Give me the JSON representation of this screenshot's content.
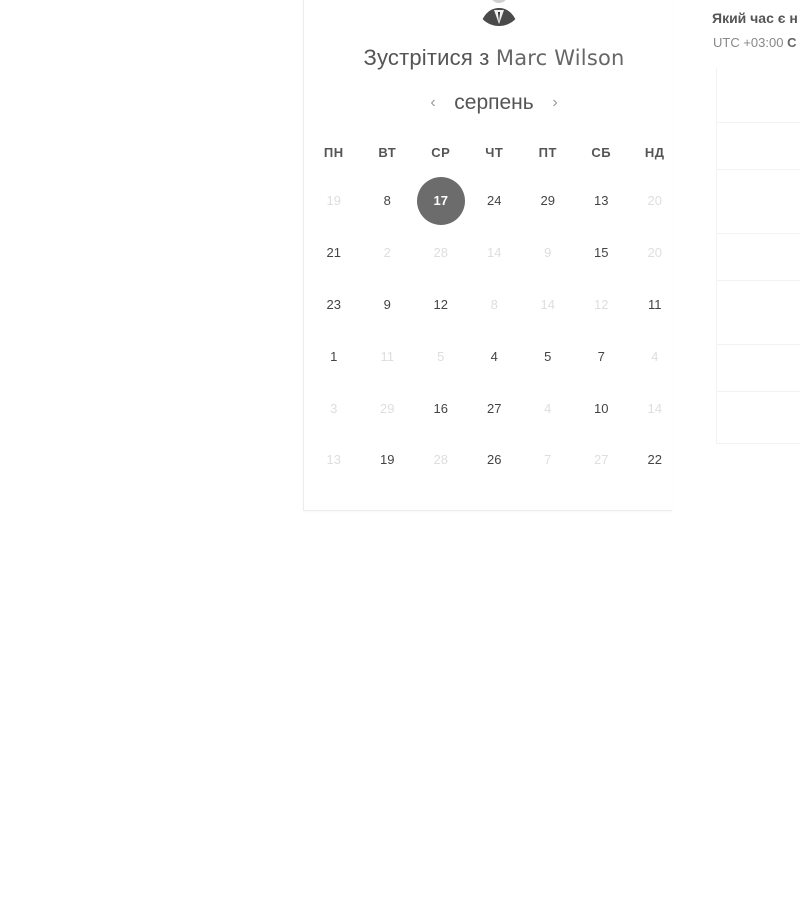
{
  "title": {
    "prefix": "Зустрітися з",
    "name": "Marc Wilson"
  },
  "calendar": {
    "month": "серпень",
    "weekdays": [
      "ПН",
      "ВТ",
      "СР",
      "ЧТ",
      "ПТ",
      "СБ",
      "НД"
    ],
    "weeks": [
      [
        {
          "d": "19",
          "m": true
        },
        {
          "d": "8"
        },
        {
          "d": "17",
          "sel": true
        },
        {
          "d": "24"
        },
        {
          "d": "29"
        },
        {
          "d": "13"
        },
        {
          "d": "20",
          "m": true
        }
      ],
      [
        {
          "d": "21"
        },
        {
          "d": "2",
          "m": true
        },
        {
          "d": "28",
          "m": true
        },
        {
          "d": "14",
          "m": true
        },
        {
          "d": "9",
          "m": true
        },
        {
          "d": "15"
        },
        {
          "d": "20",
          "m": true
        }
      ],
      [
        {
          "d": "23"
        },
        {
          "d": "9"
        },
        {
          "d": "12"
        },
        {
          "d": "8",
          "m": true
        },
        {
          "d": "14",
          "m": true
        },
        {
          "d": "12",
          "m": true
        },
        {
          "d": "11"
        }
      ],
      [
        {
          "d": "1"
        },
        {
          "d": "11",
          "m": true
        },
        {
          "d": "5",
          "m": true
        },
        {
          "d": "4"
        },
        {
          "d": "5"
        },
        {
          "d": "7"
        },
        {
          "d": "4",
          "m": true
        }
      ],
      [
        {
          "d": "3",
          "m": true
        },
        {
          "d": "29",
          "m": true
        },
        {
          "d": "16"
        },
        {
          "d": "27"
        },
        {
          "d": "4",
          "m": true
        },
        {
          "d": "10"
        },
        {
          "d": "14",
          "m": true
        }
      ],
      [
        {
          "d": "13",
          "m": true
        },
        {
          "d": "19"
        },
        {
          "d": "28",
          "m": true
        },
        {
          "d": "26"
        },
        {
          "d": "7",
          "m": true
        },
        {
          "d": "27",
          "m": true
        },
        {
          "d": "22"
        }
      ]
    ]
  },
  "timezone": {
    "question": "Який час є н",
    "value_prefix": "UTC +03:00",
    "value_suffix": "С"
  },
  "icons": {
    "prev": "chevron-left-icon",
    "next": "chevron-right-icon"
  },
  "colors": {
    "selected_day": "#6c6c6c",
    "muted_day": "#dedede"
  }
}
